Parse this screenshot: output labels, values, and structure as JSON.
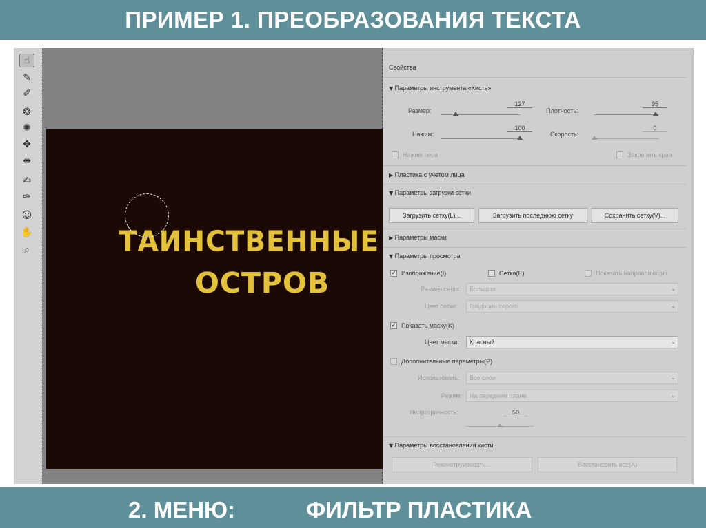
{
  "slide": {
    "title": "ПРИМЕР 1. ПРЕОБРАЗОВАНИЯ ТЕКСТА",
    "footer_part1": "2. МЕНЮ:",
    "footer_part2": "ФИЛЬТР ПЛАСТИКА"
  },
  "canvas": {
    "line1": "ТАИНСТВЕННЫЕ",
    "line2": "ОСТРОВ"
  },
  "toolbar": {
    "icons": [
      "forward-warp-tool-icon",
      "reconstruct-tool-icon",
      "smooth-tool-icon",
      "twirl-tool-icon",
      "pucker-tool-icon",
      "bloat-tool-icon",
      "push-left-tool-icon",
      "freeze-mask-tool-icon",
      "thaw-mask-tool-icon",
      "face-tool-icon",
      "hand-tool-icon",
      "zoom-tool-icon"
    ]
  },
  "panel": {
    "title": "Свойства",
    "brush_section": "Параметры инструмента «Кисть»",
    "size_label": "Размер:",
    "size_value": "127",
    "size_level": 0.18,
    "density_label": "Плотность:",
    "density_value": "95",
    "density_level": 0.95,
    "pressure_label": "Нажим:",
    "pressure_value": "100",
    "pressure_level": 1.0,
    "rate_label": "Скорость:",
    "rate_value": "0",
    "rate_level": 0.0,
    "stylus_label": "Нажим пера",
    "pin_edges_label": "Закрепить края",
    "face_section": "Пластика с учетом лица",
    "mesh_load_section": "Параметры загрузки сетки",
    "load_mesh_btn": "Загрузить сетку(L)...",
    "load_last_mesh_btn": "Загрузить последнюю сетку",
    "save_mesh_btn": "Сохранить сетку(V)...",
    "mask_section": "Параметры маски",
    "view_section": "Параметры просмотра",
    "show_image_label": "Изображение(I)",
    "show_mesh_label": "Сетка(E)",
    "show_guides_label": "Показать направляющие",
    "mesh_size_label": "Размер сетки:",
    "mesh_size_value": "Большая",
    "mesh_color_label": "Цвет сетки:",
    "mesh_color_value": "Градации серого",
    "show_mask_label": "Показать маску(K)",
    "mask_color_label": "Цвет маски:",
    "mask_color_value": "Красный",
    "backdrop_label": "Дополнительные параметры(P)",
    "use_label": "Использовать:",
    "use_value": "Все слои",
    "mode_label": "Режим:",
    "mode_value": "На переднем плане",
    "opacity_label": "Непрозрачность:",
    "opacity_value": "50",
    "opacity_level": 0.5,
    "restore_section": "Параметры восстановления кисти",
    "reconstruct_btn": "Реконструировать...",
    "restore_all_btn": "Восстановить все(A)",
    "arrow_down": "▼",
    "arrow_right": "▶",
    "check": "✓",
    "select_arrow": "⌄"
  }
}
